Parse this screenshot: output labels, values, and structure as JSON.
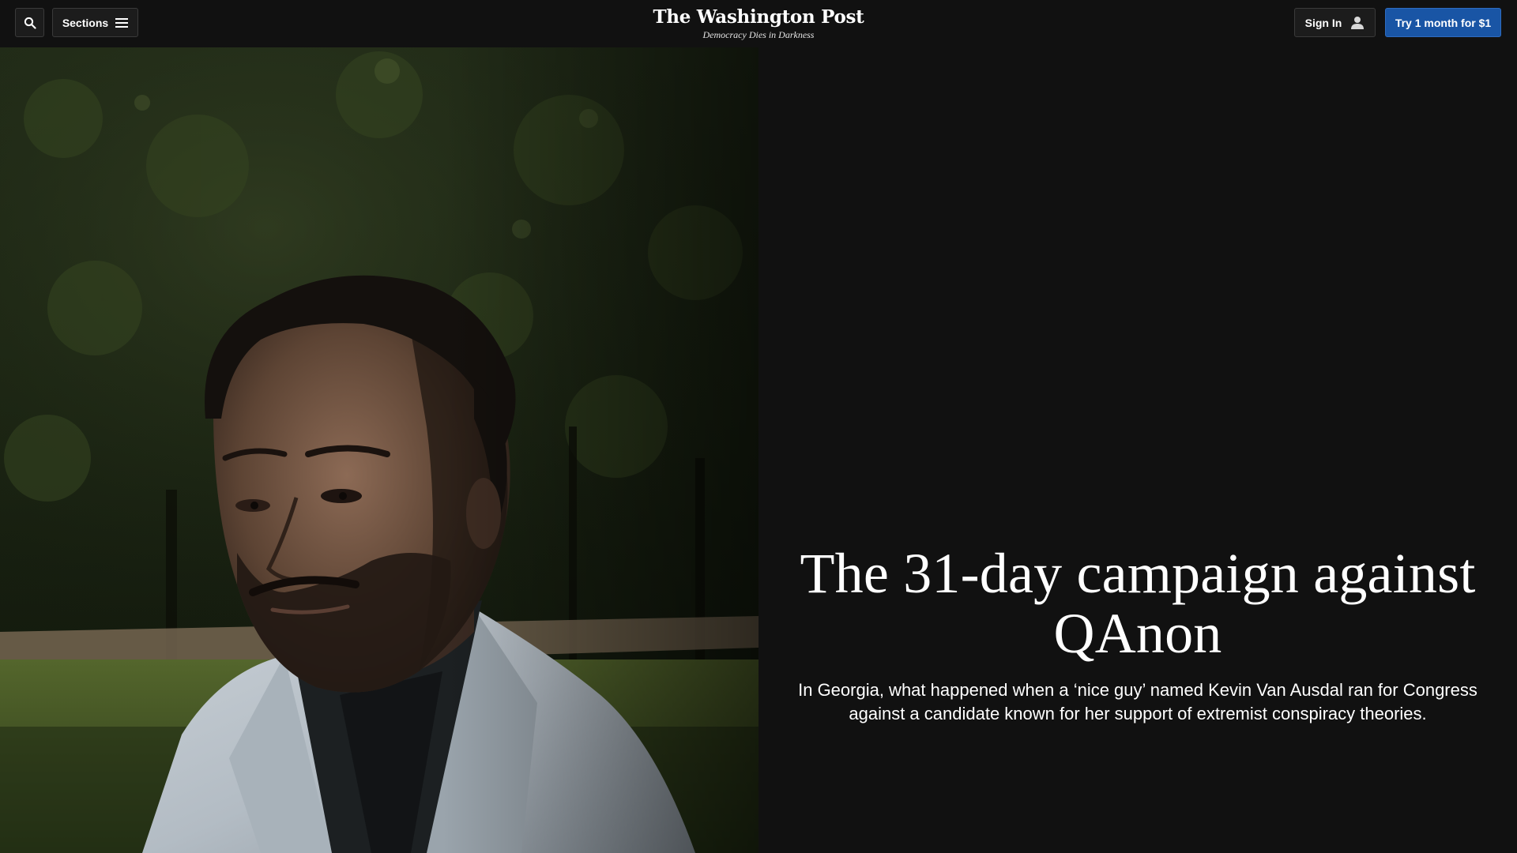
{
  "header": {
    "search_icon": "search-icon",
    "sections_label": "Sections",
    "sections_icon": "hamburger-menu-icon",
    "logo_text": "The Washington Post",
    "tagline": "Democracy Dies in Darkness",
    "signin_label": "Sign In",
    "signin_icon": "user-icon",
    "subscribe_label": "Try 1 month for $1"
  },
  "hero": {
    "image_alt": "Portrait of Kevin Van Ausdal"
  },
  "article": {
    "headline": "The 31-day campaign against QAnon",
    "dek": "In Georgia, what happened when a ‘nice guy’ named Kevin Van Ausdal ran for Congress against a candidate known for her support of extremist conspiracy theories."
  },
  "colors": {
    "page_background": "#111111",
    "subscribe_button": "#1955a5",
    "text": "#ffffff"
  }
}
